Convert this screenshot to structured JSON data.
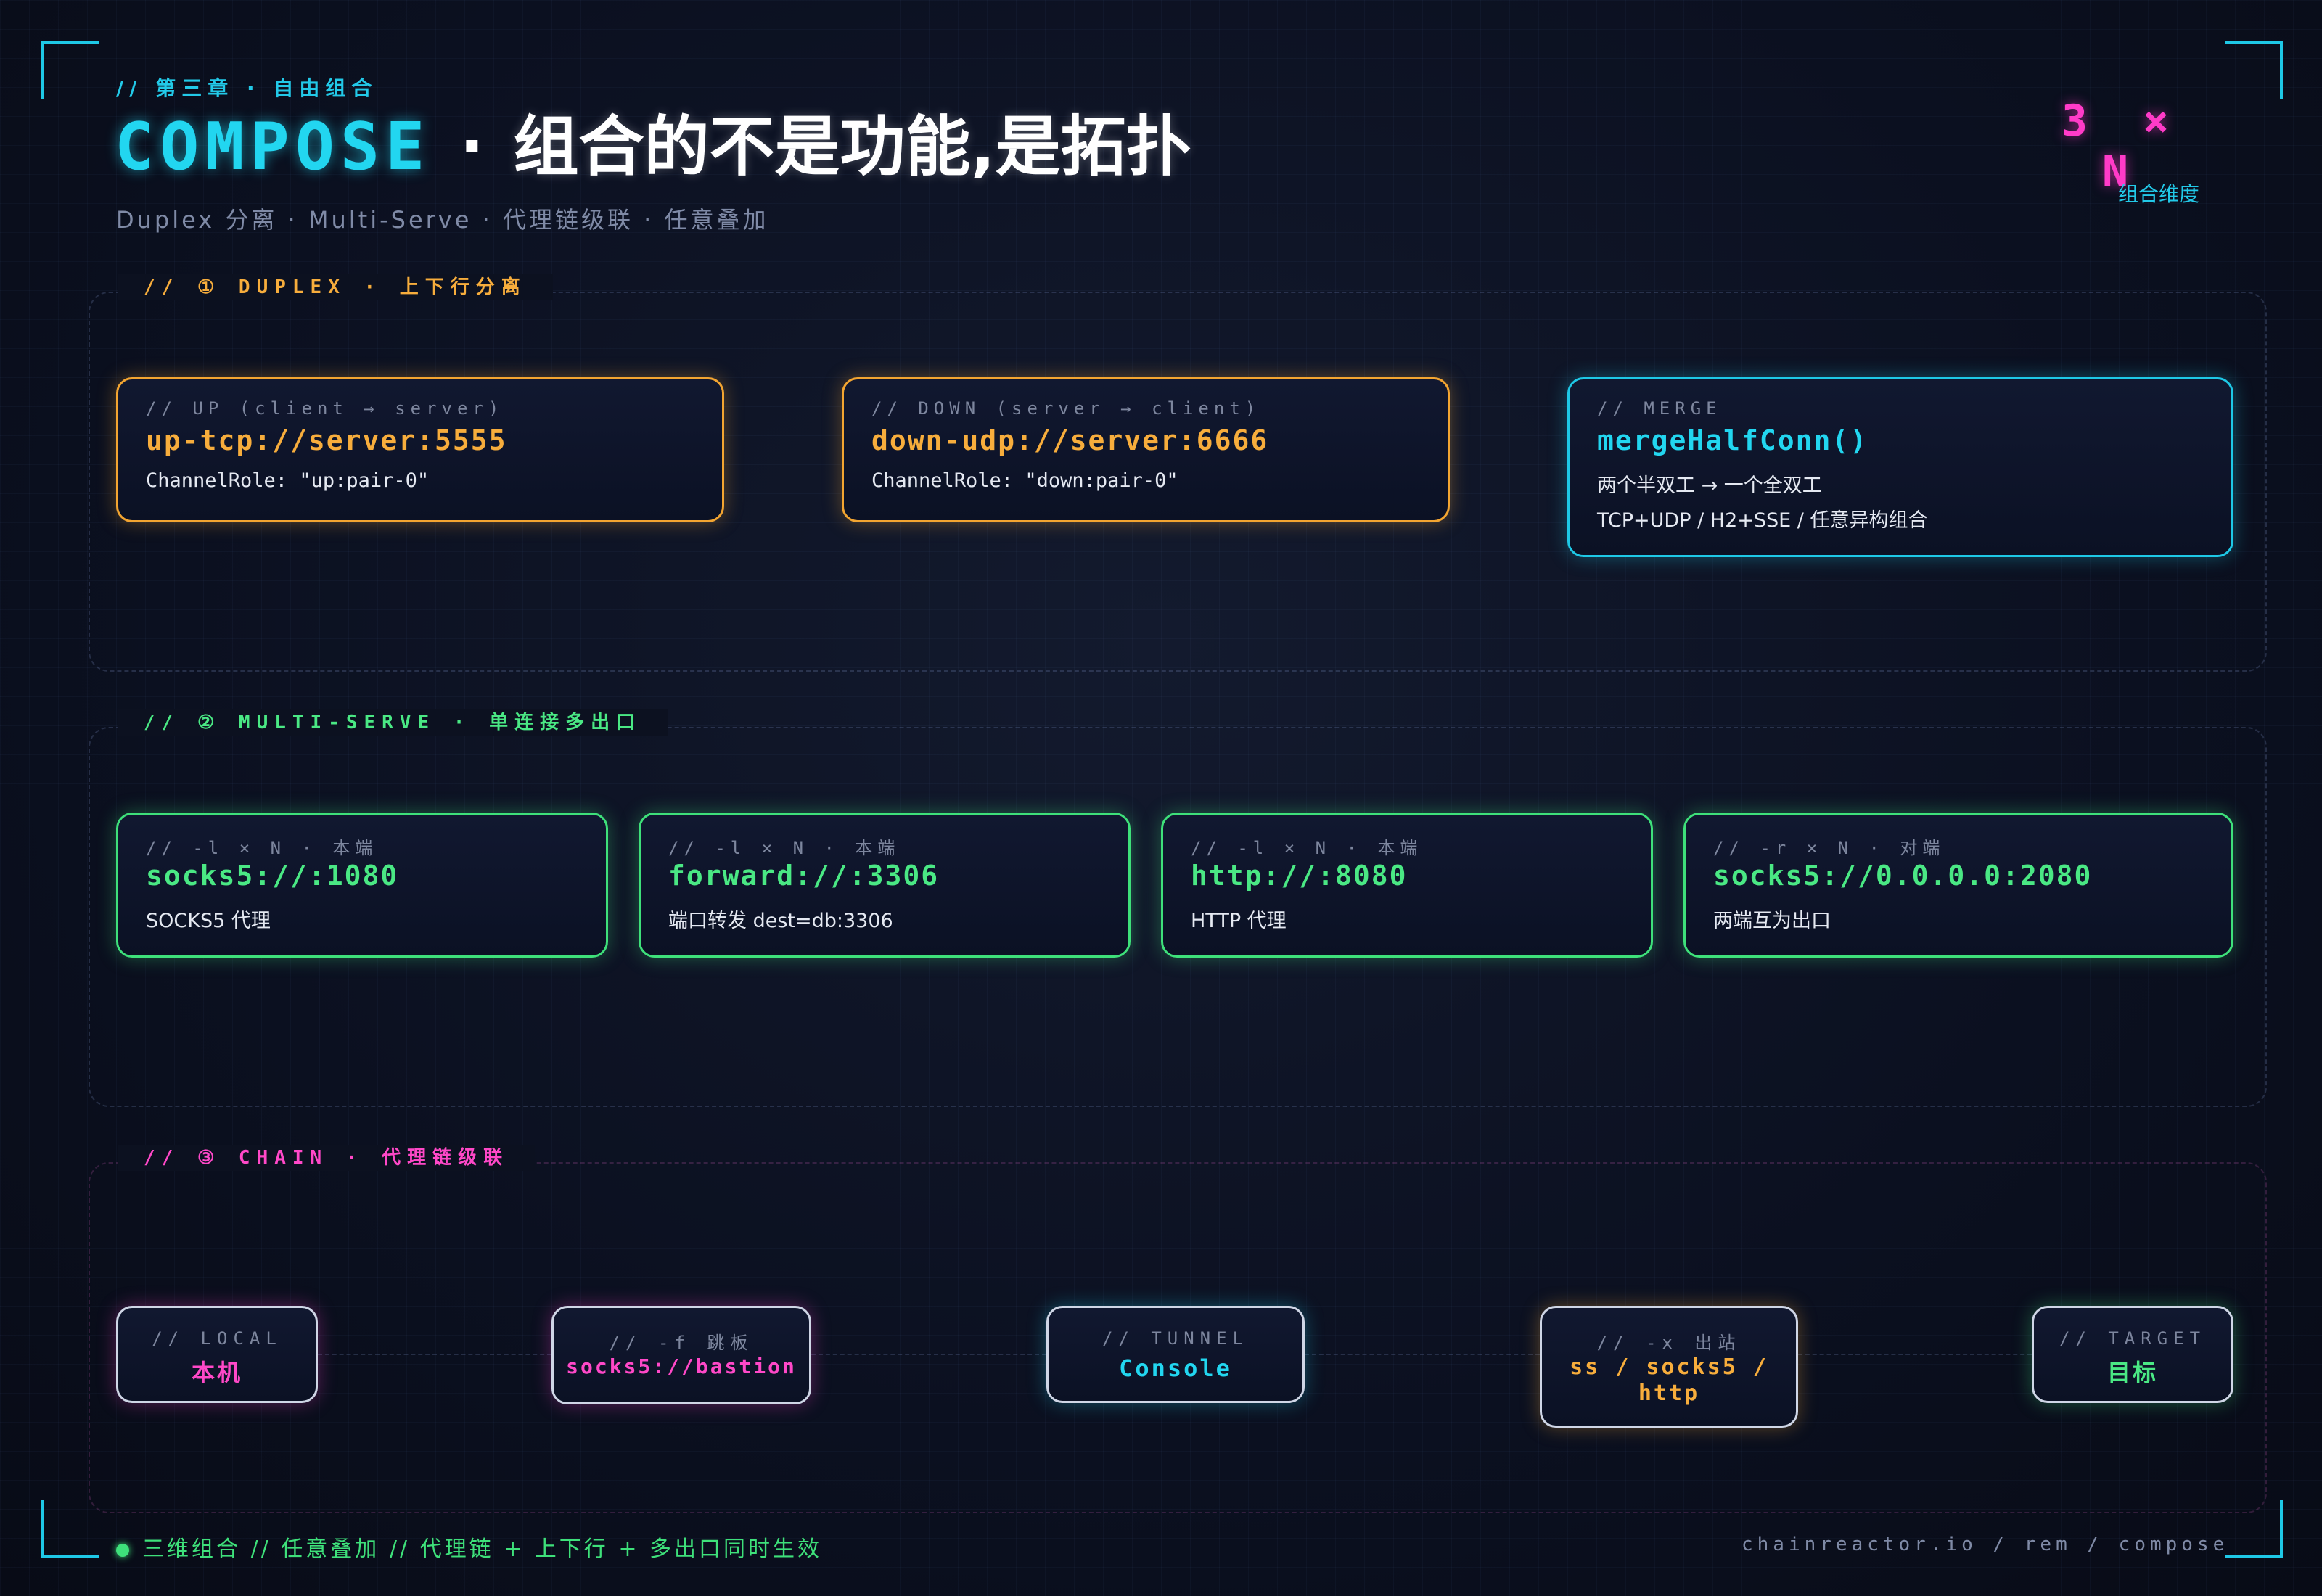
{
  "header": {
    "chapter": "//  第三章  ·  自由组合",
    "title_en": "COMPOSE",
    "title_sep": "·",
    "title_zh": "组合的不是功能,是拓扑",
    "subtitle": "Duplex 分离 · Multi-Serve · 代理链级联 · 任意叠加",
    "dimension_value": "3 × N",
    "dimension_label": "组合维度"
  },
  "colors": {
    "cyan": "#22d6f0",
    "orange": "#f7ad3c",
    "green": "#4ae884",
    "magenta": "#ff48c8",
    "background": "#0b1020"
  },
  "sections": {
    "duplex": {
      "title": "//  ①  DUPLEX  ·  上下行分离",
      "cards": [
        {
          "caption": "// UP (client → server)",
          "main": "up-tcp://server:5555",
          "sub": "ChannelRole: \"up:pair-0\""
        },
        {
          "caption": "// DOWN (server → client)",
          "main": "down-udp://server:6666",
          "sub": "ChannelRole: \"down:pair-0\""
        },
        {
          "caption": "// MERGE",
          "main": "mergeHalfConn()",
          "sub": "两个半双工 → 一个全双工",
          "sub2": "TCP+UDP / H2+SSE / 任意异构组合"
        }
      ]
    },
    "multi_serve": {
      "title": "//  ②  MULTI-SERVE  ·  单连接多出口",
      "cards": [
        {
          "caption": "// -l × N · 本端",
          "main": "socks5://:1080",
          "sub": "SOCKS5 代理"
        },
        {
          "caption": "// -l × N · 本端",
          "main": "forward://:3306",
          "sub": "端口转发 dest=db:3306"
        },
        {
          "caption": "// -l × N · 本端",
          "main": "http://:8080",
          "sub": "HTTP 代理"
        },
        {
          "caption": "// -r × N · 对端",
          "main": "socks5://0.0.0.0:2080",
          "sub": "两端互为出口"
        }
      ]
    },
    "chain": {
      "title": "//  ③  CHAIN  ·  代理链级联",
      "nodes": [
        {
          "caption": "// LOCAL",
          "main": "本机"
        },
        {
          "caption": "// -f 跳板",
          "main": "socks5://bastion"
        },
        {
          "caption": "// TUNNEL",
          "main": "Console"
        },
        {
          "caption": "// -x 出站",
          "main": "ss / socks5 / http"
        },
        {
          "caption": "// TARGET",
          "main": "目标"
        }
      ]
    }
  },
  "footer": {
    "left": "三维组合 // 任意叠加 // 代理链 + 上下行 + 多出口同时生效",
    "right": "chainreactor.io / rem / compose"
  }
}
